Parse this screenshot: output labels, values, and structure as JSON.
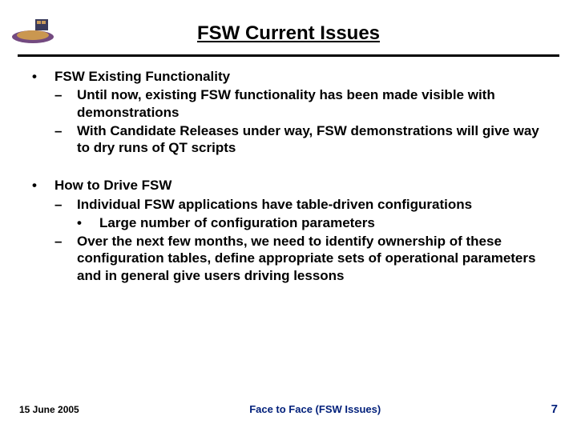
{
  "title": "FSW Current Issues",
  "sections": [
    {
      "heading": "FSW Existing Functionality",
      "items": [
        {
          "level": 2,
          "text": "Until now, existing FSW functionality has been made visible with demonstrations"
        },
        {
          "level": 2,
          "text": "With Candidate Releases under way, FSW demonstrations will give way to dry runs of QT scripts"
        }
      ]
    },
    {
      "heading": "How to Drive FSW",
      "items": [
        {
          "level": 2,
          "text": "Individual FSW applications have table-driven configurations"
        },
        {
          "level": 3,
          "text": "Large number of configuration parameters"
        },
        {
          "level": 2,
          "text": "Over the next few months, we need to identify ownership of these configuration tables, define appropriate sets of operational parameters and in general give users driving lessons"
        }
      ]
    }
  ],
  "footer": {
    "date": "15 June 2005",
    "center": "Face to Face (FSW Issues)",
    "page": "7"
  },
  "bullets": {
    "l1": "•",
    "l2": "–",
    "l3": "•"
  }
}
